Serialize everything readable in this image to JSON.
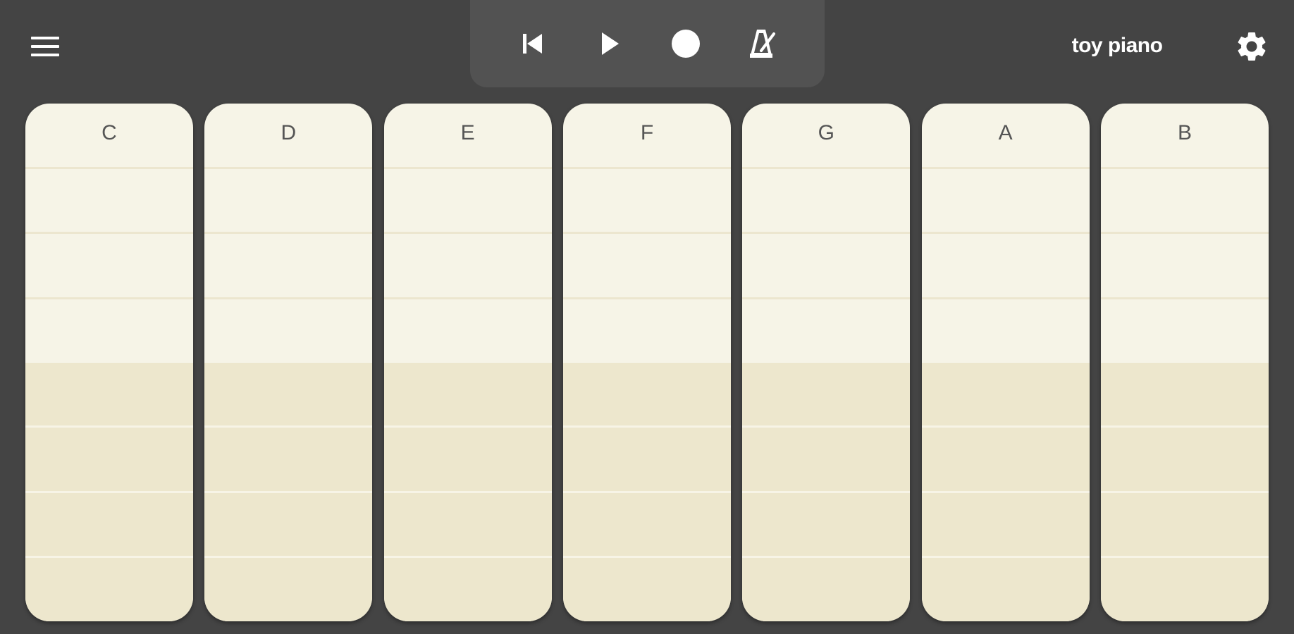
{
  "app": {
    "title": "toy piano",
    "background_color": "#444444"
  },
  "toolbar": {
    "menu_icon": "hamburger-menu-icon",
    "transport": [
      {
        "name": "skip-to-start",
        "icon": "skip-back-icon"
      },
      {
        "name": "play",
        "icon": "play-icon"
      },
      {
        "name": "record",
        "icon": "record-icon"
      },
      {
        "name": "metronome",
        "icon": "metronome-icon"
      }
    ],
    "settings_icon": "gear-icon"
  },
  "keys": [
    {
      "note": "C"
    },
    {
      "note": "D"
    },
    {
      "note": "E"
    },
    {
      "note": "F"
    },
    {
      "note": "G"
    },
    {
      "note": "A"
    },
    {
      "note": "B"
    }
  ],
  "colors": {
    "key_upper": "#f6f4e7",
    "key_lower": "#ede7cd",
    "transport_bg": "#525252"
  }
}
